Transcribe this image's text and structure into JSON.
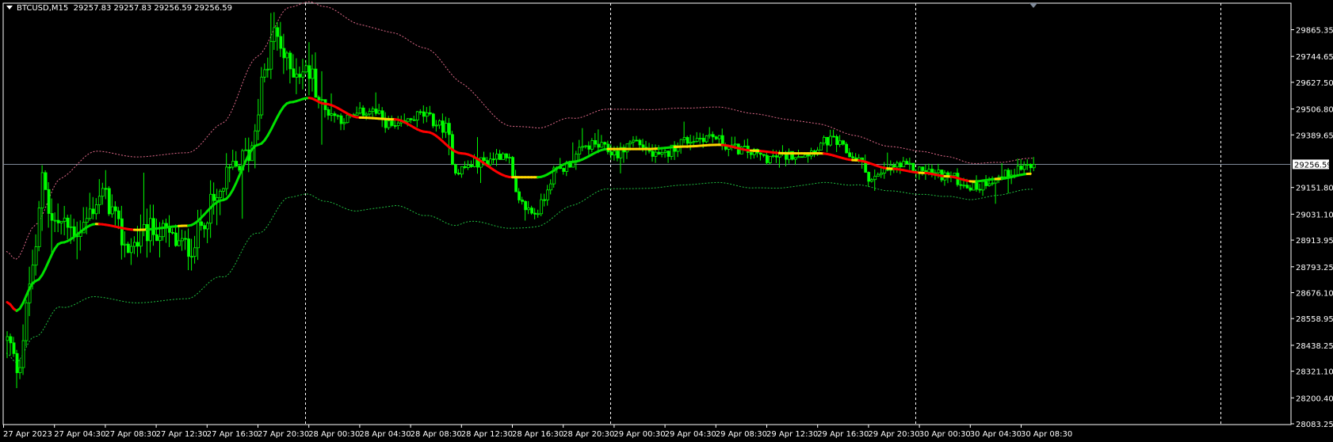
{
  "header": {
    "symbol": "BTCUSD,M15",
    "ohlc": "29257.83 29257.83 29256.59 29256.59"
  },
  "colors": {
    "background": "#000000",
    "frame": "#ffffff",
    "candle": "#00ff00",
    "ma_up": "#00e000",
    "ma_down": "#ff0000",
    "ma_flat": "#ffd700",
    "band_upper": "#e06a8a",
    "band_lower": "#1fbf3f",
    "grid": "#ffffff",
    "current_line": "#7f8a99"
  },
  "chart_data": {
    "type": "candlestick",
    "timeframe": "M15",
    "bar_count": 324,
    "ylim": [
      28083.25,
      29865.35
    ],
    "y_ticks": [
      "29865.35",
      "29744.65",
      "29627.50",
      "29506.80",
      "29389.65",
      "29151.80",
      "29031.10",
      "28913.95",
      "28793.25",
      "28676.10",
      "28558.95",
      "28438.25",
      "28321.10",
      "28200.40",
      "28083.25"
    ],
    "current_price": "29256.59",
    "x_ticks": [
      "27 Apr 2023",
      "27 Apr 04:30",
      "27 Apr 08:30",
      "27 Apr 12:30",
      "27 Apr 16:30",
      "27 Apr 20:30",
      "28 Apr 00:30",
      "28 Apr 04:30",
      "28 Apr 08:30",
      "28 Apr 12:30",
      "28 Apr 16:30",
      "28 Apr 20:30",
      "29 Apr 00:30",
      "29 Apr 04:30",
      "29 Apr 08:30",
      "29 Apr 12:30",
      "29 Apr 16:30",
      "29 Apr 20:30",
      "30 Apr 00:30",
      "30 Apr 04:30",
      "30 Apr 08:30"
    ],
    "day_separators_bar": [
      94,
      190,
      286,
      382
    ],
    "price_anchors": [
      [
        0,
        28460
      ],
      [
        3,
        28344
      ],
      [
        9,
        28845
      ],
      [
        11,
        29230
      ],
      [
        14,
        28999
      ],
      [
        22,
        28960
      ],
      [
        30,
        29114
      ],
      [
        38,
        28883
      ],
      [
        46,
        28960
      ],
      [
        57,
        28883
      ],
      [
        65,
        29076
      ],
      [
        71,
        29230
      ],
      [
        76,
        29307
      ],
      [
        81,
        29653
      ],
      [
        84,
        29846
      ],
      [
        89,
        29692
      ],
      [
        95,
        29672
      ],
      [
        100,
        29499
      ],
      [
        106,
        29461
      ],
      [
        114,
        29499
      ],
      [
        122,
        29422
      ],
      [
        130,
        29480
      ],
      [
        138,
        29422
      ],
      [
        141,
        29230
      ],
      [
        149,
        29268
      ],
      [
        157,
        29307
      ],
      [
        161,
        29076
      ],
      [
        166,
        29037
      ],
      [
        173,
        29230
      ],
      [
        184,
        29345
      ],
      [
        192,
        29307
      ],
      [
        197,
        29364
      ],
      [
        205,
        29287
      ],
      [
        213,
        29364
      ],
      [
        221,
        29384
      ],
      [
        229,
        29326
      ],
      [
        240,
        29287
      ],
      [
        251,
        29307
      ],
      [
        259,
        29364
      ],
      [
        267,
        29287
      ],
      [
        272,
        29191
      ],
      [
        280,
        29249
      ],
      [
        288,
        29230
      ],
      [
        294,
        29210
      ],
      [
        305,
        29153
      ],
      [
        310,
        29191
      ],
      [
        321,
        29249
      ],
      [
        323,
        29256.59
      ]
    ],
    "ma_anchors": [
      [
        0,
        28633
      ],
      [
        3,
        28594
      ],
      [
        9,
        28729
      ],
      [
        17,
        28902
      ],
      [
        28,
        28987
      ],
      [
        41,
        28960
      ],
      [
        57,
        28979
      ],
      [
        68,
        29095
      ],
      [
        79,
        29345
      ],
      [
        89,
        29537
      ],
      [
        95,
        29557
      ],
      [
        100,
        29530
      ],
      [
        111,
        29468
      ],
      [
        122,
        29460
      ],
      [
        132,
        29403
      ],
      [
        143,
        29306
      ],
      [
        159,
        29198
      ],
      [
        167,
        29198
      ],
      [
        178,
        29268
      ],
      [
        189,
        29326
      ],
      [
        202,
        29326
      ],
      [
        213,
        29337
      ],
      [
        224,
        29345
      ],
      [
        235,
        29318
      ],
      [
        245,
        29306
      ],
      [
        256,
        29306
      ],
      [
        267,
        29275
      ],
      [
        278,
        29237
      ],
      [
        288,
        29218
      ],
      [
        296,
        29202
      ],
      [
        304,
        29179
      ],
      [
        312,
        29191
      ],
      [
        322,
        29214
      ]
    ],
    "band_dev_anchors": [
      [
        0,
        230
      ],
      [
        30,
        330
      ],
      [
        60,
        330
      ],
      [
        90,
        430
      ],
      [
        100,
        440
      ],
      [
        130,
        380
      ],
      [
        160,
        230
      ],
      [
        190,
        180
      ],
      [
        230,
        170
      ],
      [
        280,
        100
      ],
      [
        322,
        70
      ]
    ],
    "ma_slope_threshold": 1.2
  }
}
